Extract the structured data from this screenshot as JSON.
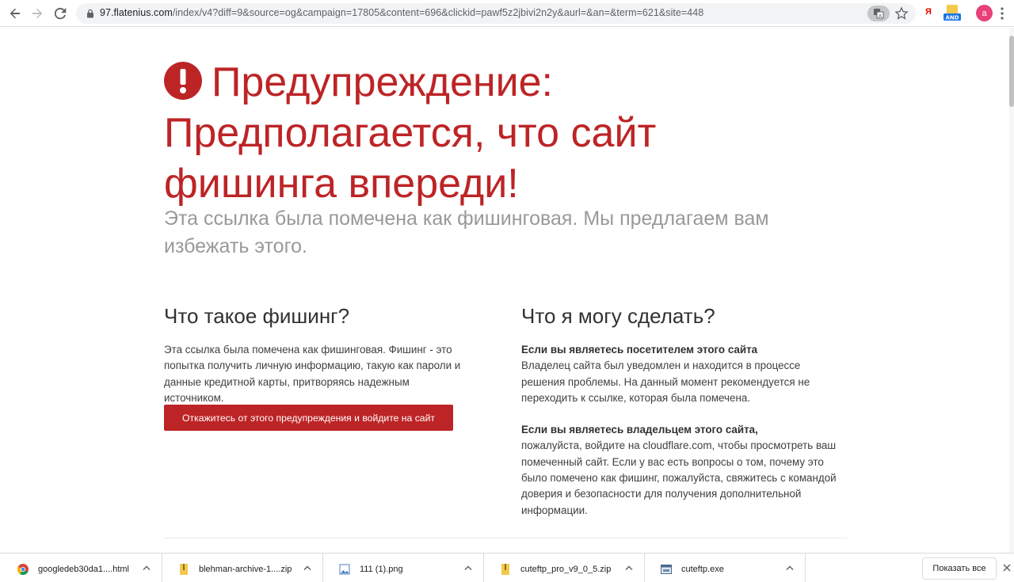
{
  "browser": {
    "url_host": "97.flatenius.com",
    "url_path": "/index/v4?diff=9&source=og&campaign=17805&content=696&clickid=pawf5z2jbivi2n2y&aurl=&an=&term=621&site=448",
    "ext_ya_label": "Я",
    "ext_and_label": "AND",
    "avatar_letter": "a"
  },
  "warning": {
    "title": "Предупреждение: Предполагается, что сайт фишинга впереди!",
    "subtitle": "Эта ссылка была помечена как фишинговая. Мы предлагаем вам избежать этого."
  },
  "left_column": {
    "heading": "Что такое фишинг?",
    "body": "Эта ссылка была помечена как фишинговая. Фишинг - это попытка получить личную информацию, такую как пароли и данные кредитной карты, притворяясь надежным источником.",
    "button_label": "Откажитесь от этого предупреждения и войдите на сайт"
  },
  "right_column": {
    "heading": "Что я могу сделать?",
    "visitor_title": "Если вы являетесь посетителем этого сайта",
    "visitor_body": "Владелец сайта был уведомлен и находится в процессе решения проблемы. На данный момент рекомендуется не переходить к ссылке, которая была помечена.",
    "owner_title": "Если вы являетесь владельцем этого сайта,",
    "owner_body_pre": "пожалуйста, войдите на ",
    "owner_link": "cloudflare.com",
    "owner_body_post": ", чтобы просмотреть ваш помеченный сайт. Если у вас есть вопросы о том, почему это было помечено как фишинг, пожалуйста, свяжитесь с командой доверия и безопасности для получения дополнительной информации."
  },
  "downloads": {
    "items": [
      {
        "name": "googledeb30da1....html",
        "icon": "chrome-icon"
      },
      {
        "name": "blehman-archive-1....zip",
        "icon": "zip-icon"
      },
      {
        "name": "111 (1).png",
        "icon": "image-icon"
      },
      {
        "name": "cuteftp_pro_v9_0_5.zip",
        "icon": "zip-icon"
      },
      {
        "name": "cuteftp.exe",
        "icon": "exe-icon"
      }
    ],
    "show_all_label": "Показать все"
  },
  "colors": {
    "accent_red": "#bd2426",
    "subtitle_gray": "#999999",
    "heading_dark": "#313131"
  }
}
